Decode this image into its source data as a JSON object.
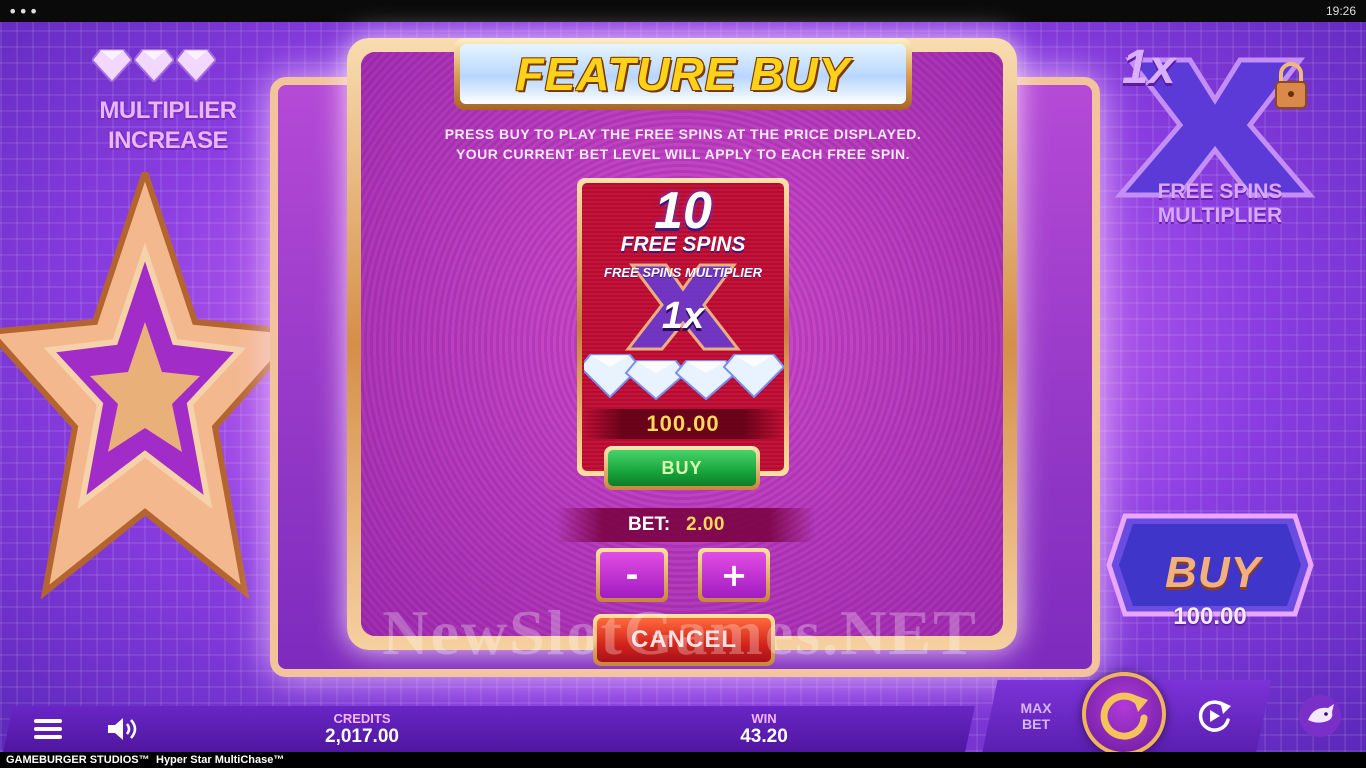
{
  "status_bar": {
    "menu_dots": "•••",
    "time": "19:26"
  },
  "left_panel": {
    "feature_label": "MULTIPLIER INCREASE"
  },
  "right_panel": {
    "multiplier_value": "1x",
    "multiplier_label": "FREE SPINS MULTIPLIER",
    "buy_label": "BUY",
    "buy_price": "100.00"
  },
  "popup": {
    "title": "FEATURE BUY",
    "instructions_line1": "PRESS BUY TO PLAY THE FREE SPINS AT THE PRICE DISPLAYED.",
    "instructions_line2": "YOUR CURRENT BET LEVEL WILL APPLY TO EACH FREE SPIN.",
    "card": {
      "spins_count": "10",
      "spins_label": "FREE SPINS",
      "multiplier_caption": "FREE SPINS MULTIPLIER",
      "multiplier_value": "1x",
      "price": "100.00",
      "buy_label": "BUY"
    },
    "bet_label": "BET:",
    "bet_value": "2.00",
    "minus_label": "-",
    "plus_label": "+",
    "cancel_label": "CANCEL"
  },
  "watermark": "NewSlotGames.NET",
  "controls": {
    "credits_label": "CREDITS",
    "credits_value": "2,017.00",
    "win_label": "WIN",
    "win_value": "43.20",
    "max_bet_label": "MAX BET"
  },
  "footer": {
    "studio": "GAMEBURGER STUDIOS™",
    "game": "Hyper Star MultiChase™"
  },
  "icons": {
    "menu": "hamburger-menu-icon",
    "sound": "speaker-icon",
    "spin": "spin-arrow-icon",
    "autoplay": "autoplay-icon",
    "mascot": "mascot-icon",
    "lock": "lock-icon"
  },
  "colors": {
    "accent_gold": "#ffd21a",
    "price_gold": "#ffd85a",
    "buy_green": "#17a43c",
    "cancel_red": "#d2241c",
    "panel_purple": "#6a25c6"
  }
}
